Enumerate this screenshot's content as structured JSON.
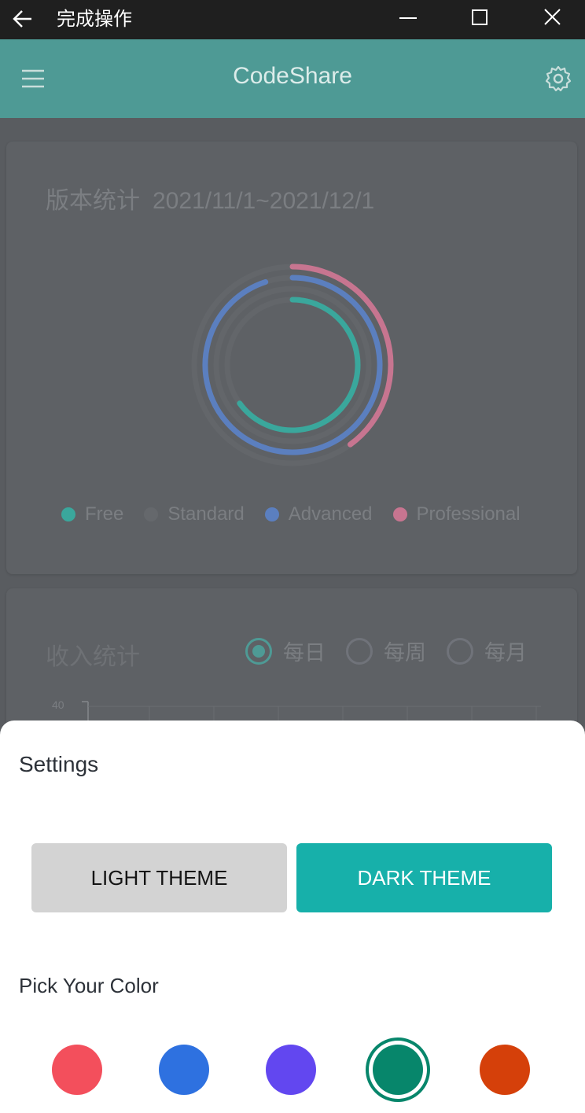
{
  "titlebar": {
    "title": "完成操作",
    "icons": [
      "back-arrow-icon",
      "minimize-icon",
      "maximize-icon",
      "close-icon"
    ]
  },
  "appbar": {
    "title": "CodeShare",
    "icons": [
      "hamburger-menu-icon",
      "gear-icon"
    ]
  },
  "version_card": {
    "title": "版本统计",
    "range": "2021/11/1~2021/12/1",
    "legend": [
      {
        "label": "Free",
        "color": "#3aa79c"
      },
      {
        "label": "Standard",
        "color": "#5e6165"
      },
      {
        "label": "Advanced",
        "color": "#5b7fbf"
      },
      {
        "label": "Professional",
        "color": "#c77590"
      }
    ],
    "rings": [
      {
        "series": "Free",
        "fraction": 0.65
      },
      {
        "series": "Standard",
        "fraction": 0.0
      },
      {
        "series": "Advanced",
        "fraction": 0.95
      },
      {
        "series": "Professional",
        "fraction": 0.4
      }
    ]
  },
  "income_card": {
    "title": "收入统计",
    "periods": [
      {
        "label": "每日",
        "selected": true
      },
      {
        "label": "每周",
        "selected": false
      },
      {
        "label": "每月",
        "selected": false
      }
    ],
    "y_tick": "40"
  },
  "settings_sheet": {
    "heading": "Settings",
    "light_label": "LIGHT THEME",
    "dark_label": "DARK THEME",
    "pick_label": "Pick Your Color",
    "colors": [
      "#f34f5c",
      "#2e71e0",
      "#6247f0",
      "#07866b",
      "#d5400a"
    ],
    "selected_color": "#07866b"
  }
}
